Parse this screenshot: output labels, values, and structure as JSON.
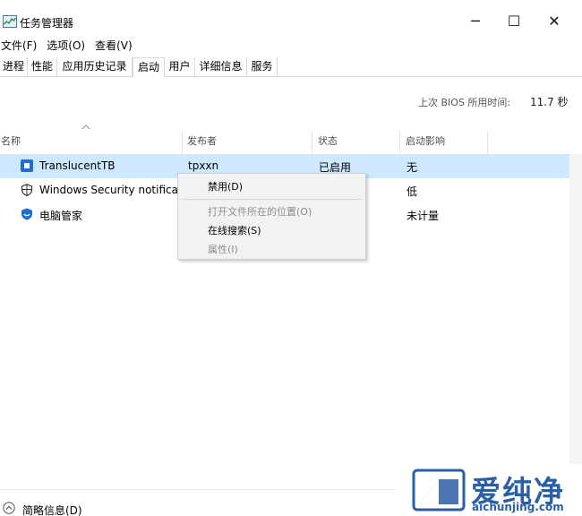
{
  "window": {
    "title": "任务管理器",
    "controls": {
      "minimize": "─",
      "maximize": "☐",
      "close": "✕"
    }
  },
  "menu": [
    {
      "label": "文件(F)"
    },
    {
      "label": "选项(O)"
    },
    {
      "label": "查看(V)"
    }
  ],
  "tabs": [
    {
      "label": "进程"
    },
    {
      "label": "性能"
    },
    {
      "label": "应用历史记录"
    },
    {
      "label": "启动"
    },
    {
      "label": "用户"
    },
    {
      "label": "详细信息"
    },
    {
      "label": "服务"
    }
  ],
  "active_tab": "启动",
  "bios": {
    "label": "上次 BIOS 所用时间:",
    "value": "11.7 秒"
  },
  "columns": [
    {
      "label": "名称"
    },
    {
      "label": "发布者"
    },
    {
      "label": "状态"
    },
    {
      "label": "启动影响"
    }
  ],
  "rows": [
    {
      "name": "TranslucentTB",
      "publisher": "tpxxn",
      "status": "已启用",
      "impact": "无",
      "icon": "translucenttb-icon",
      "selected": true
    },
    {
      "name": "Windows Security notifica...",
      "publisher": "",
      "status": "",
      "impact": "低",
      "icon": "shield-icon",
      "selected": false
    },
    {
      "name": "电脑管家",
      "publisher": "",
      "status": "",
      "impact": "未计量",
      "icon": "pc-manager-icon",
      "selected": false
    }
  ],
  "context_menu": {
    "items": [
      {
        "label": "禁用(D)",
        "enabled": true
      },
      {
        "label": "打开文件所在的位置(O)",
        "enabled": false
      },
      {
        "label": "在线搜索(S)",
        "enabled": true
      },
      {
        "label": "属性(I)",
        "enabled": false
      }
    ]
  },
  "footer": {
    "details_label": "简略信息(D)"
  },
  "watermark": {
    "chars": "爱纯净",
    "url": "aichunjing.com"
  },
  "colors": {
    "selection": "#cde8ff",
    "border": "#d9d9d9",
    "watermark": "#2a5fa5",
    "row_icon_blue": "#1c6fd1"
  }
}
